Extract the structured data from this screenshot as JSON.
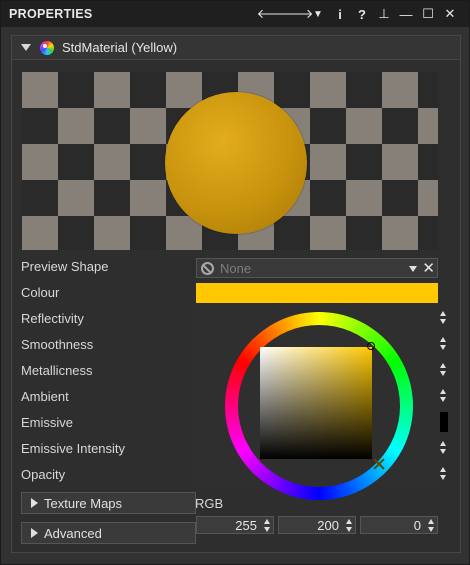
{
  "window": {
    "title": "PROPERTIES",
    "icons": [
      "arrow-left-icon",
      "arrow-right-icon",
      "dropdown-icon",
      "info-icon",
      "help-icon",
      "pin-icon",
      "minimize-icon",
      "maximize-icon",
      "close-icon"
    ],
    "icon_glyphs": [
      "🡐",
      "🡒",
      "▼",
      "i",
      "?",
      "⊥",
      "—",
      "☐",
      "✕"
    ]
  },
  "material": {
    "title": "StdMaterial (Yellow)",
    "sphere_color": "#c8930d"
  },
  "properties": {
    "preview_shape": {
      "label": "Preview Shape",
      "value": "None"
    },
    "colour": {
      "label": "Colour",
      "value": "#ffc800"
    },
    "reflectivity": {
      "label": "Reflectivity"
    },
    "smoothness": {
      "label": "Smoothness"
    },
    "metallicness": {
      "label": "Metallicness"
    },
    "ambient": {
      "label": "Ambient"
    },
    "emissive": {
      "label": "Emissive",
      "value": "#000000"
    },
    "emissive_intensity": {
      "label": "Emissive Intensity"
    },
    "opacity": {
      "label": "Opacity"
    }
  },
  "sections": {
    "texture_maps": "Texture Maps",
    "advanced": "Advanced"
  },
  "color_picker": {
    "mode_label": "RGB",
    "r": "255",
    "g": "200",
    "b": "0"
  }
}
